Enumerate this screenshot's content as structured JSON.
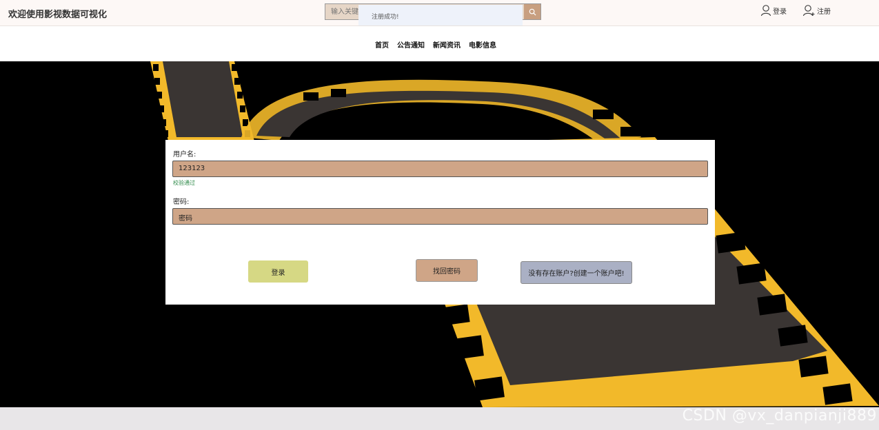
{
  "header": {
    "site_title": "欢迎使用影视数据可视化",
    "search_placeholder": "输入关键",
    "login_label": "登录",
    "register_label": "注册"
  },
  "toast": {
    "message": "注册成功!"
  },
  "nav": {
    "items": [
      {
        "label": "首页"
      },
      {
        "label": "公告通知"
      },
      {
        "label": "新闻资讯"
      },
      {
        "label": "电影信息"
      }
    ]
  },
  "login_form": {
    "username_label": "用户名:",
    "username_value": "123123",
    "username_status": "校验通过",
    "password_label": "密码:",
    "password_value": "密码",
    "login_button": "登录",
    "forgot_button": "找回密码",
    "register_link": "没有存在账户?创建一个账户吧!"
  },
  "footer": {
    "watermark": "CSDN @vx_danpianji889"
  },
  "colors": {
    "field_bg": "#cfa587",
    "login_button": "#d6d884",
    "register_button": "#aab0c4",
    "film_yellow": "#f2b92a",
    "film_gray": "#3a3533"
  }
}
